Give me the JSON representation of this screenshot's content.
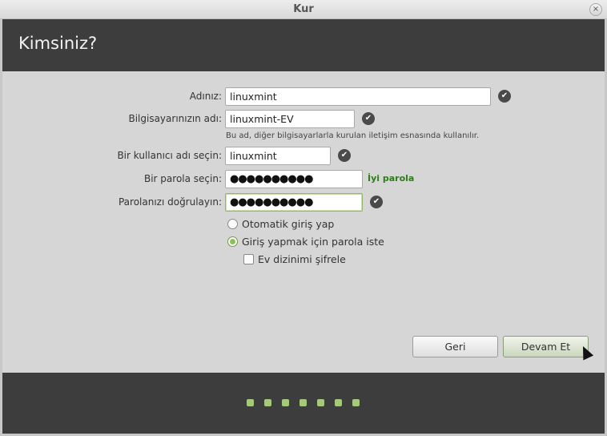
{
  "window": {
    "title": "Kur",
    "close_glyph": "×"
  },
  "header": {
    "title": "Kimsiniz?"
  },
  "form": {
    "name": {
      "label": "Adınız:",
      "value": "linuxmint"
    },
    "computer": {
      "label": "Bilgisayarınızın adı:",
      "value": "linuxmint-EV",
      "hint": "Bu ad, diğer bilgisayarlarla kurulan iletişim esnasında kullanılır."
    },
    "username": {
      "label": "Bir kullanıcı adı seçin:",
      "value": "linuxmint"
    },
    "password": {
      "label": "Bir parola seçin:",
      "value": "●●●●●●●●●●",
      "strength": "İyi parola"
    },
    "confirm": {
      "label": "Parolanızı doğrulayın:",
      "value": "●●●●●●●●●●"
    },
    "options": {
      "auto_login": {
        "label": "Otomatik giriş yap",
        "selected": false
      },
      "require_password": {
        "label": "Giriş yapmak için parola iste",
        "selected": true
      },
      "encrypt_home": {
        "label": "Ev dizinimi şifrele",
        "checked": false
      }
    }
  },
  "buttons": {
    "back": "Geri",
    "next": "Devam Et"
  },
  "icons": {
    "valid": "checkmark-icon"
  },
  "progress": {
    "steps_total": 7
  },
  "colors": {
    "header_bg": "#3d3d3d",
    "accent_green": "#8cbf5a",
    "strength_text": "#2d7d1a"
  }
}
